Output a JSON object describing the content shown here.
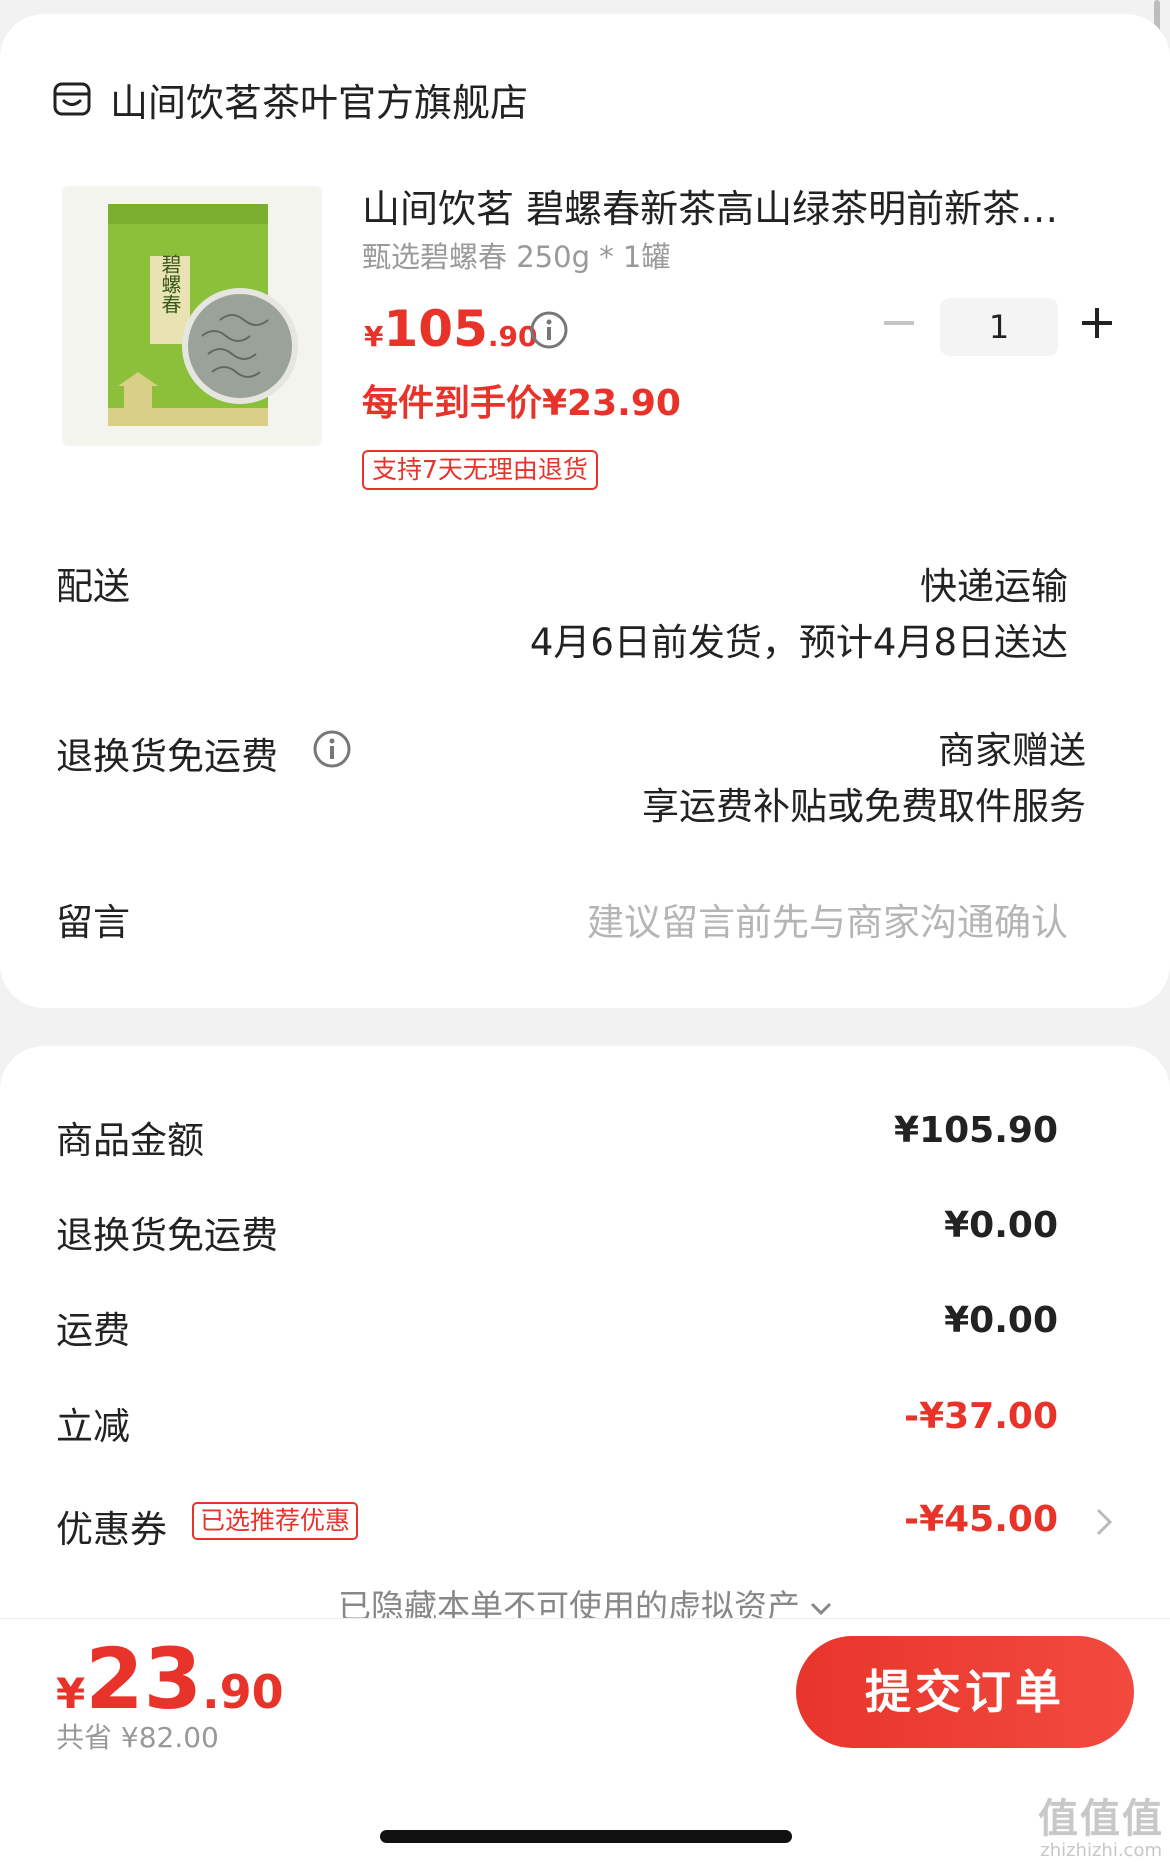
{
  "store": {
    "name": "山间饮茗茶叶官方旗舰店",
    "icon": "store-icon"
  },
  "product": {
    "title": "山间饮茗 碧螺春新茶高山绿茶明前新茶…",
    "spec": "甄选碧螺春 250g * 1罐",
    "price_symbol": "¥",
    "price_int": "105",
    "price_dec": ".90",
    "unit_price": "每件到手价¥23.90",
    "return_badge": "支持7天无理由退货",
    "quantity": "1",
    "image_text": "碧螺春"
  },
  "delivery": {
    "label": "配送",
    "method": "快递运输",
    "time": "4月6日前发货，预计4月8日送达"
  },
  "return_shipping": {
    "label": "退换货免运费",
    "value": "商家赠送",
    "desc": "享运费补贴或免费取件服务"
  },
  "message": {
    "label": "留言",
    "placeholder": "建议留言前先与商家沟通确认"
  },
  "summary": {
    "goods_label": "商品金额",
    "goods_value": "¥105.90",
    "rship_label": "退换货免运费",
    "rship_value": "¥0.00",
    "freight_label": "运费",
    "freight_value": "¥0.00",
    "discount_label": "立减",
    "discount_value": "-¥37.00",
    "coupon_label": "优惠券",
    "coupon_badge": "已选推荐优惠",
    "coupon_value": "-¥45.00",
    "hidden_assets": "已隐藏本单不可使用的虚拟资产"
  },
  "footer": {
    "total_symbol": "¥",
    "total_int": "23",
    "total_dec": ".90",
    "saved": "共省 ¥82.00",
    "submit": "提交订单"
  },
  "watermark": {
    "main": "值值值",
    "sub": "zhizhizhi.com"
  },
  "colors": {
    "accent": "#e8332a",
    "muted": "#9a9a9a",
    "background": "#f2f2f2"
  }
}
